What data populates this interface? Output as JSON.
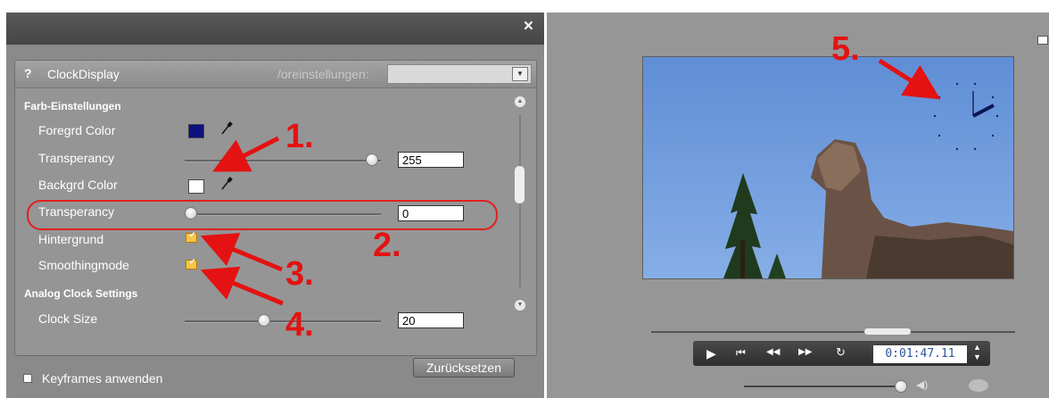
{
  "window": {
    "close_label": "×"
  },
  "effect": {
    "help": "?",
    "title": "ClockDisplay",
    "preset_label": "/oreinstellungen:",
    "preset_value": "",
    "preset_arrow": "▼"
  },
  "sections": {
    "color": "Farb-Einstellungen",
    "analog": "Analog Clock Settings"
  },
  "params": {
    "foregrd_color": {
      "label": "Foregrd Color",
      "color": "#0d1280"
    },
    "transparency1": {
      "label": "Transperancy",
      "value": "255",
      "level": 0.95
    },
    "backgrd_color": {
      "label": "Backgrd Color",
      "color": "#ffffff"
    },
    "transparency2": {
      "label": "Transperancy",
      "value": "0",
      "level": 0.0
    },
    "hintergrund": {
      "label": "Hintergrund",
      "checked": true
    },
    "smoothing": {
      "label": "Smoothingmode",
      "checked": true
    },
    "clock_size": {
      "label": "Clock Size",
      "value": "20",
      "level": 0.4
    }
  },
  "footer": {
    "keyframes_label": "Keyframes anwenden",
    "reset_label": "Zurücksetzen"
  },
  "annotations": [
    "1.",
    "2.",
    "3.",
    "4.",
    "5."
  ],
  "annotation_color": "#e41212",
  "player": {
    "timecode": "0:01:47.11",
    "play": "▶",
    "to_start": "⏮",
    "rewind": "◀◀",
    "forward": "▶▶",
    "loop": "↻",
    "spin_up": "▲",
    "spin_down": "▼",
    "speaker": "◀)",
    "scrub_position": 0.65,
    "volume_level": 0.97
  },
  "icons": {
    "pipette": "pipette-icon",
    "check": "✔"
  }
}
